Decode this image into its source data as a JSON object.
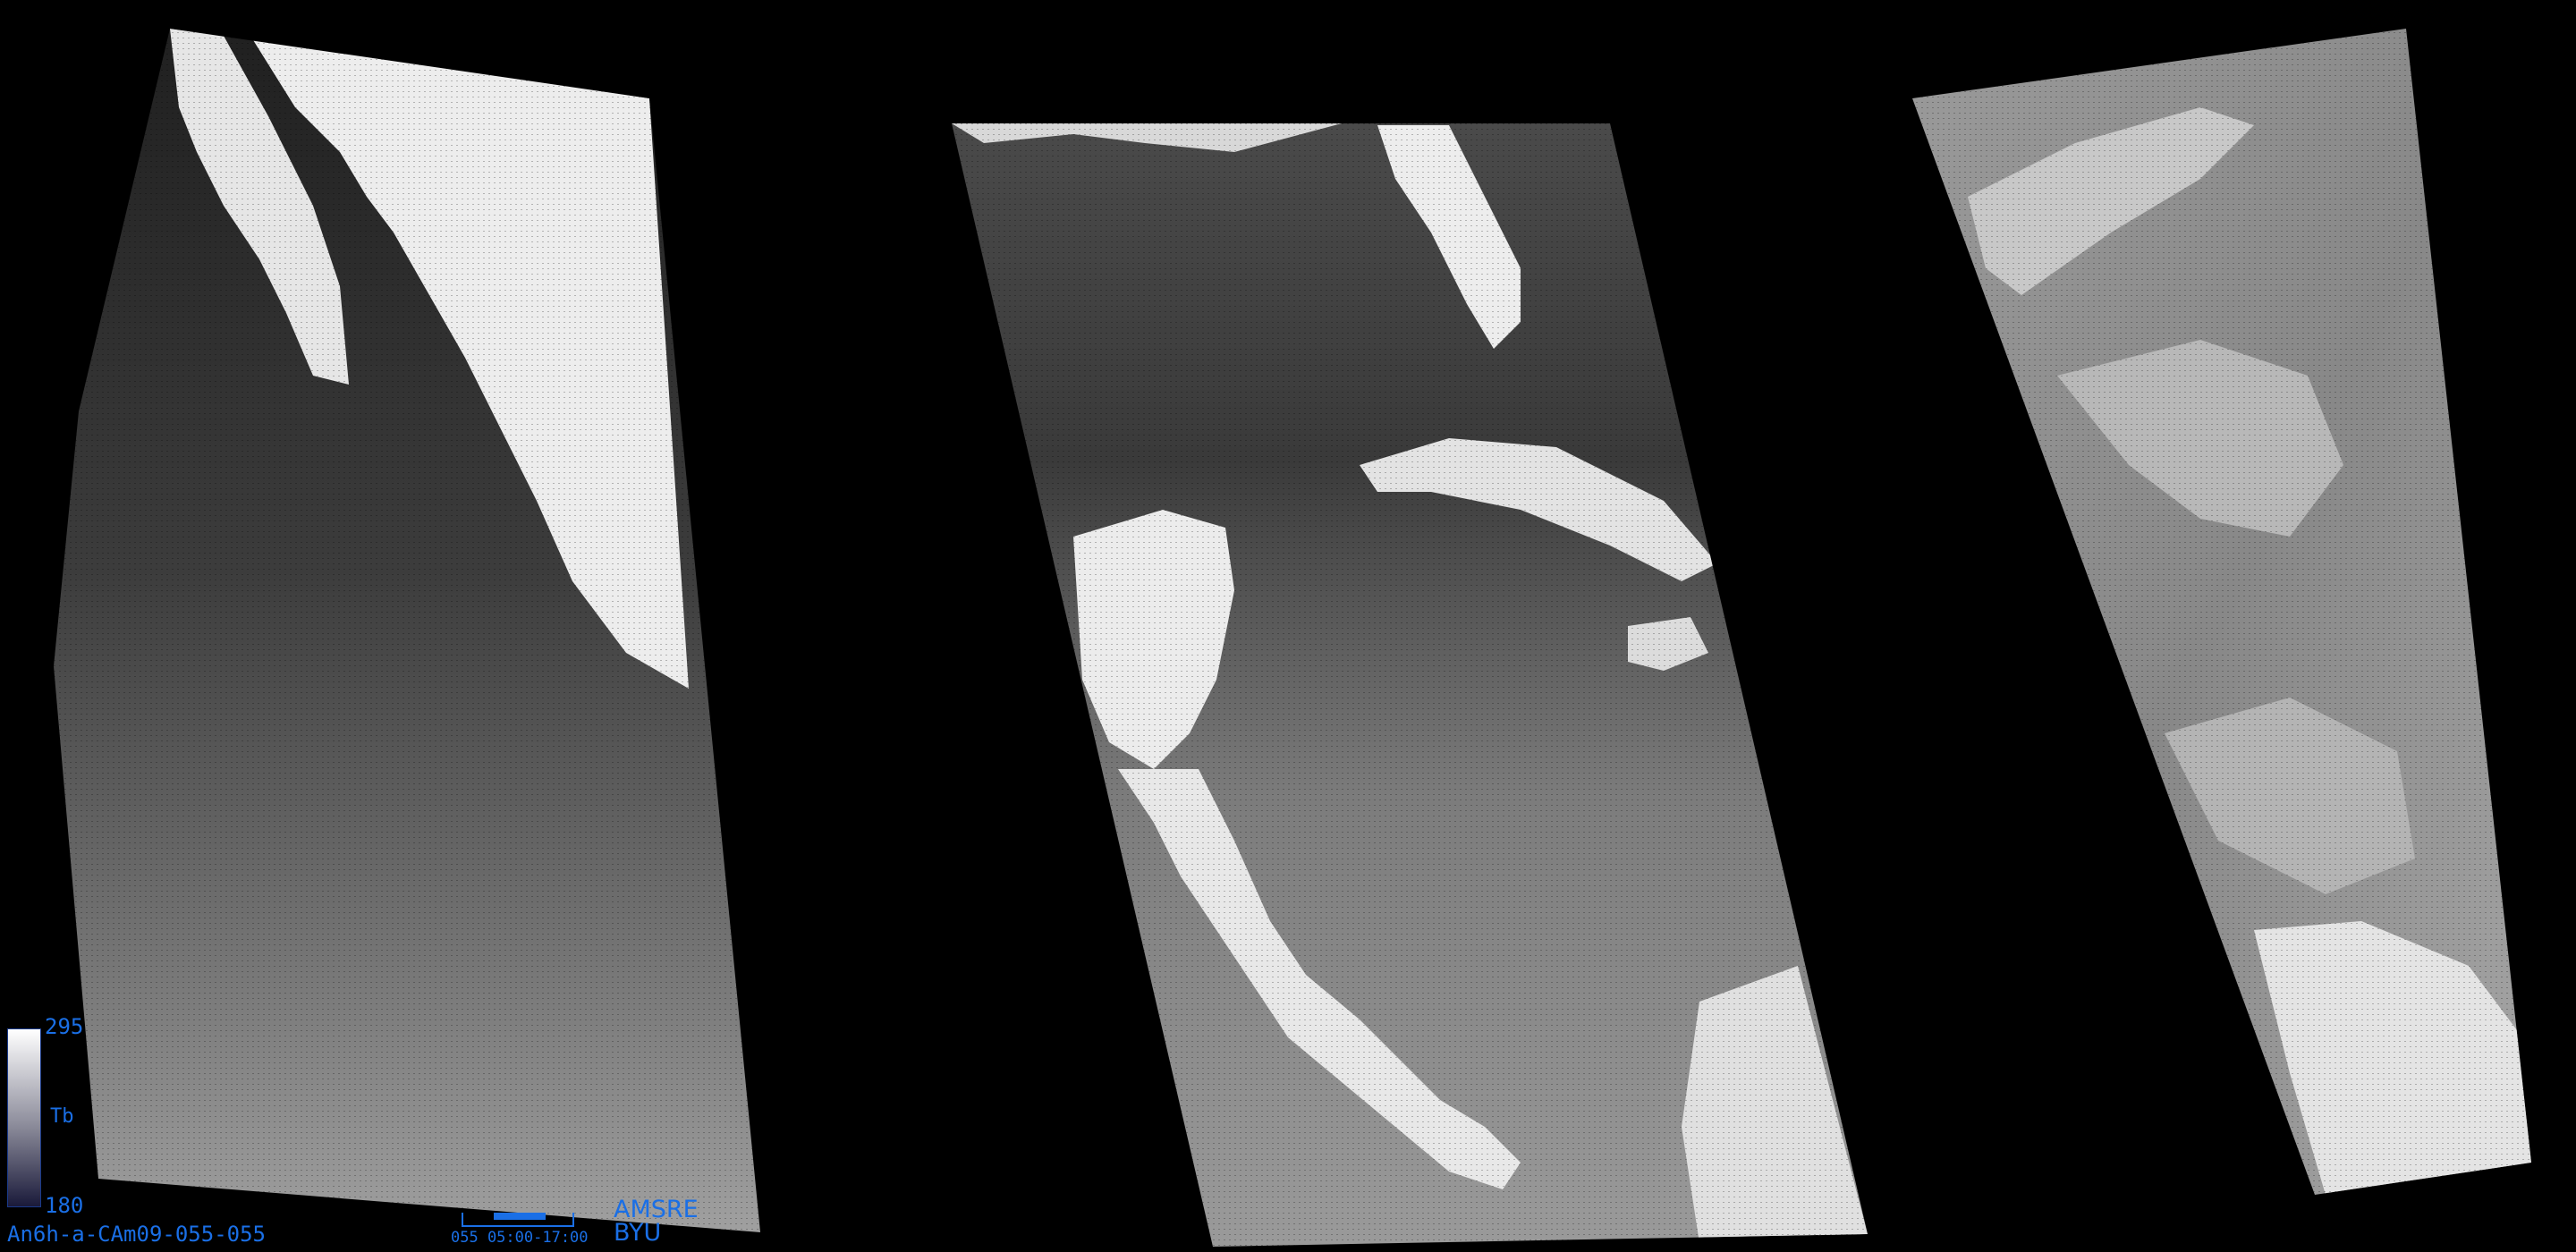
{
  "image_label": "An6h-a-CAm09-055-055",
  "colorbar": {
    "max": "295",
    "min": "180",
    "label": "Tb"
  },
  "time_axis": {
    "top_text": "",
    "label": "055 05:00-17:00"
  },
  "credits": {
    "sensor": "AMSRE",
    "organization": "BYU"
  },
  "colors": {
    "background": "#000000",
    "annotation_blue": "#1a6fe6",
    "ocean_dark": "#3a3a3a",
    "ocean_mid": "#7a7a7a",
    "land_bright": "#f0f0f0"
  }
}
